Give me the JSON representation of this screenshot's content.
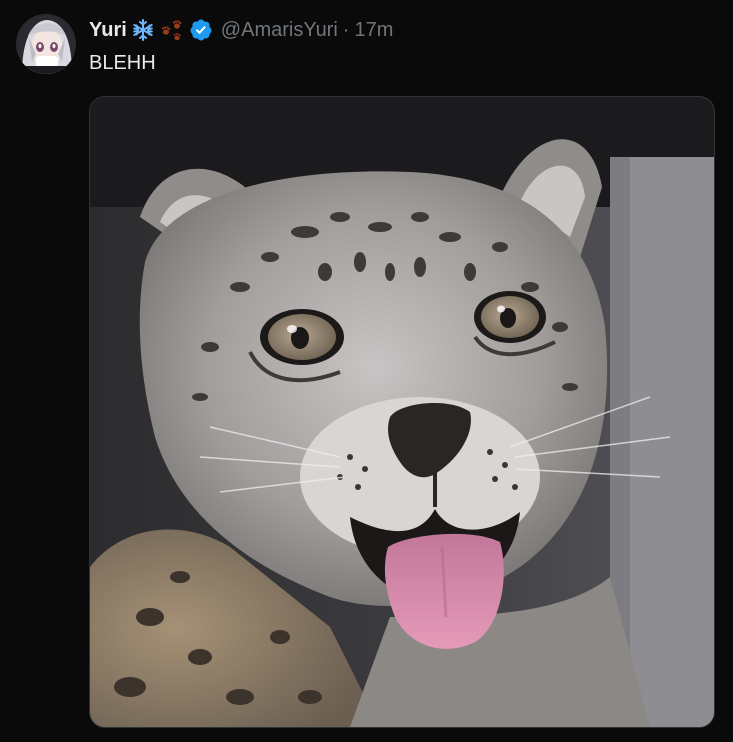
{
  "tweet": {
    "display_name": "Yuri",
    "emojis": [
      "snowflake-icon",
      "paw-prints-icon"
    ],
    "verified": true,
    "handle": "@AmarisYuri",
    "separator": "·",
    "time": "17m",
    "text": "BLEHH"
  },
  "colors": {
    "background": "#0a0a0a",
    "text": "#e7e9ea",
    "secondary_text": "#71767b",
    "verified_blue": "#1d9bf0",
    "snowflake": "#6fb6ff",
    "paw": "#9b3b1e"
  }
}
